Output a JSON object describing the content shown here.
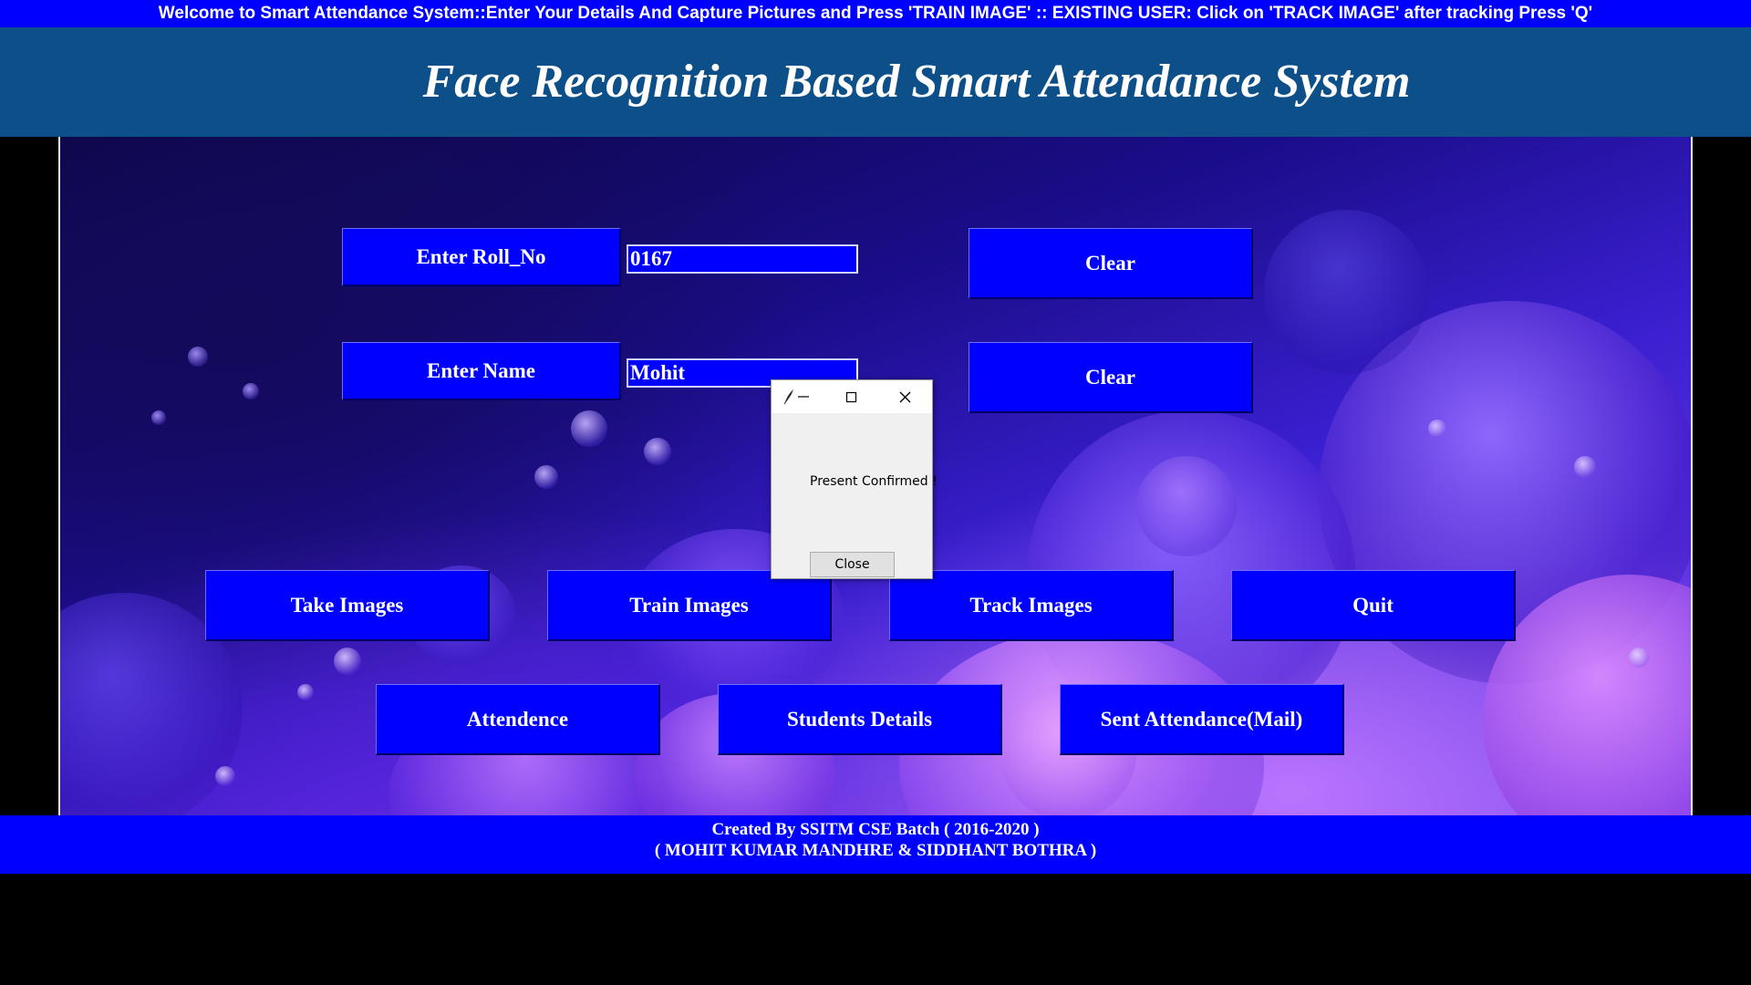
{
  "marquee": {
    "text": "Welcome to Smart Attendance System::Enter Your Details And Capture Pictures and Press 'TRAIN IMAGE' :: EXISTING USER: Click on 'TRACK IMAGE' after tracking Press 'Q'"
  },
  "header": {
    "title": "Face Recognition Based Smart Attendance System"
  },
  "form": {
    "roll_label": "Enter Roll_No",
    "roll_value": "0167",
    "name_label": "Enter Name",
    "name_value": "Mohit",
    "clear_roll_label": "Clear",
    "clear_name_label": "Clear"
  },
  "actions": {
    "take_images": "Take Images",
    "train_images": "Train Images",
    "track_images": "Track Images",
    "quit": "Quit",
    "attendence": "Attendence",
    "students_details": "Students Details",
    "sent_attendance": "Sent Attendance(Mail)"
  },
  "footer": {
    "line1": "Created By SSITM CSE Batch ( 2016-2020 )",
    "line2": "( MOHIT KUMAR MANDHRE & SIDDHANT BOTHRA )"
  },
  "dialog": {
    "message": "Present Confirmed !",
    "close_label": "Close"
  },
  "colors": {
    "button_blue": "#0000ff",
    "header_blue": "#0d4f88"
  }
}
